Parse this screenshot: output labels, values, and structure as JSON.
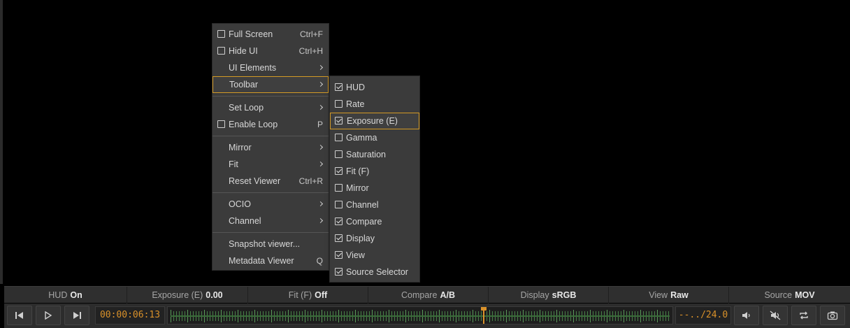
{
  "main_menu": {
    "full_screen": {
      "label": "Full Screen",
      "shortcut": "Ctrl+F",
      "checked": false
    },
    "hide_ui": {
      "label": "Hide UI",
      "shortcut": "Ctrl+H",
      "checked": false
    },
    "ui_elements": {
      "label": "UI Elements"
    },
    "toolbar": {
      "label": "Toolbar"
    },
    "set_loop": {
      "label": "Set Loop"
    },
    "enable_loop": {
      "label": "Enable Loop",
      "shortcut": "P",
      "checked": false
    },
    "mirror": {
      "label": "Mirror"
    },
    "fit": {
      "label": "Fit"
    },
    "reset_viewer": {
      "label": "Reset Viewer",
      "shortcut": "Ctrl+R"
    },
    "ocio": {
      "label": "OCIO"
    },
    "channel": {
      "label": "Channel"
    },
    "snapshot_viewer": {
      "label": "Snapshot viewer..."
    },
    "metadata_viewer": {
      "label": "Metadata Viewer",
      "shortcut": "Q"
    }
  },
  "toolbar_submenu": [
    {
      "label": "HUD",
      "checked": true
    },
    {
      "label": "Rate",
      "checked": false
    },
    {
      "label": "Exposure (E)",
      "checked": true
    },
    {
      "label": "Gamma",
      "checked": false
    },
    {
      "label": "Saturation",
      "checked": false
    },
    {
      "label": "Fit (F)",
      "checked": true
    },
    {
      "label": "Mirror",
      "checked": false
    },
    {
      "label": "Channel",
      "checked": false
    },
    {
      "label": "Compare",
      "checked": true
    },
    {
      "label": "Display",
      "checked": true
    },
    {
      "label": "View",
      "checked": true
    },
    {
      "label": "Source Selector",
      "checked": true
    }
  ],
  "hud": {
    "hud": {
      "label": "HUD",
      "value": "On"
    },
    "exposure": {
      "label": "Exposure (E)",
      "value": "0.00"
    },
    "fit": {
      "label": "Fit (F)",
      "value": "Off"
    },
    "compare": {
      "label": "Compare",
      "value": "A/B"
    },
    "display": {
      "label": "Display",
      "value": "sRGB"
    },
    "view": {
      "label": "View",
      "value": "Raw"
    },
    "source": {
      "label": "Source",
      "value": "MOV"
    }
  },
  "transport": {
    "timecode": "00:00:06:13",
    "fps": "--../24.0",
    "playhead_fraction": 0.625
  },
  "colors": {
    "accent": "#d9912a",
    "timeline_ticks": "#4c8c4c"
  }
}
